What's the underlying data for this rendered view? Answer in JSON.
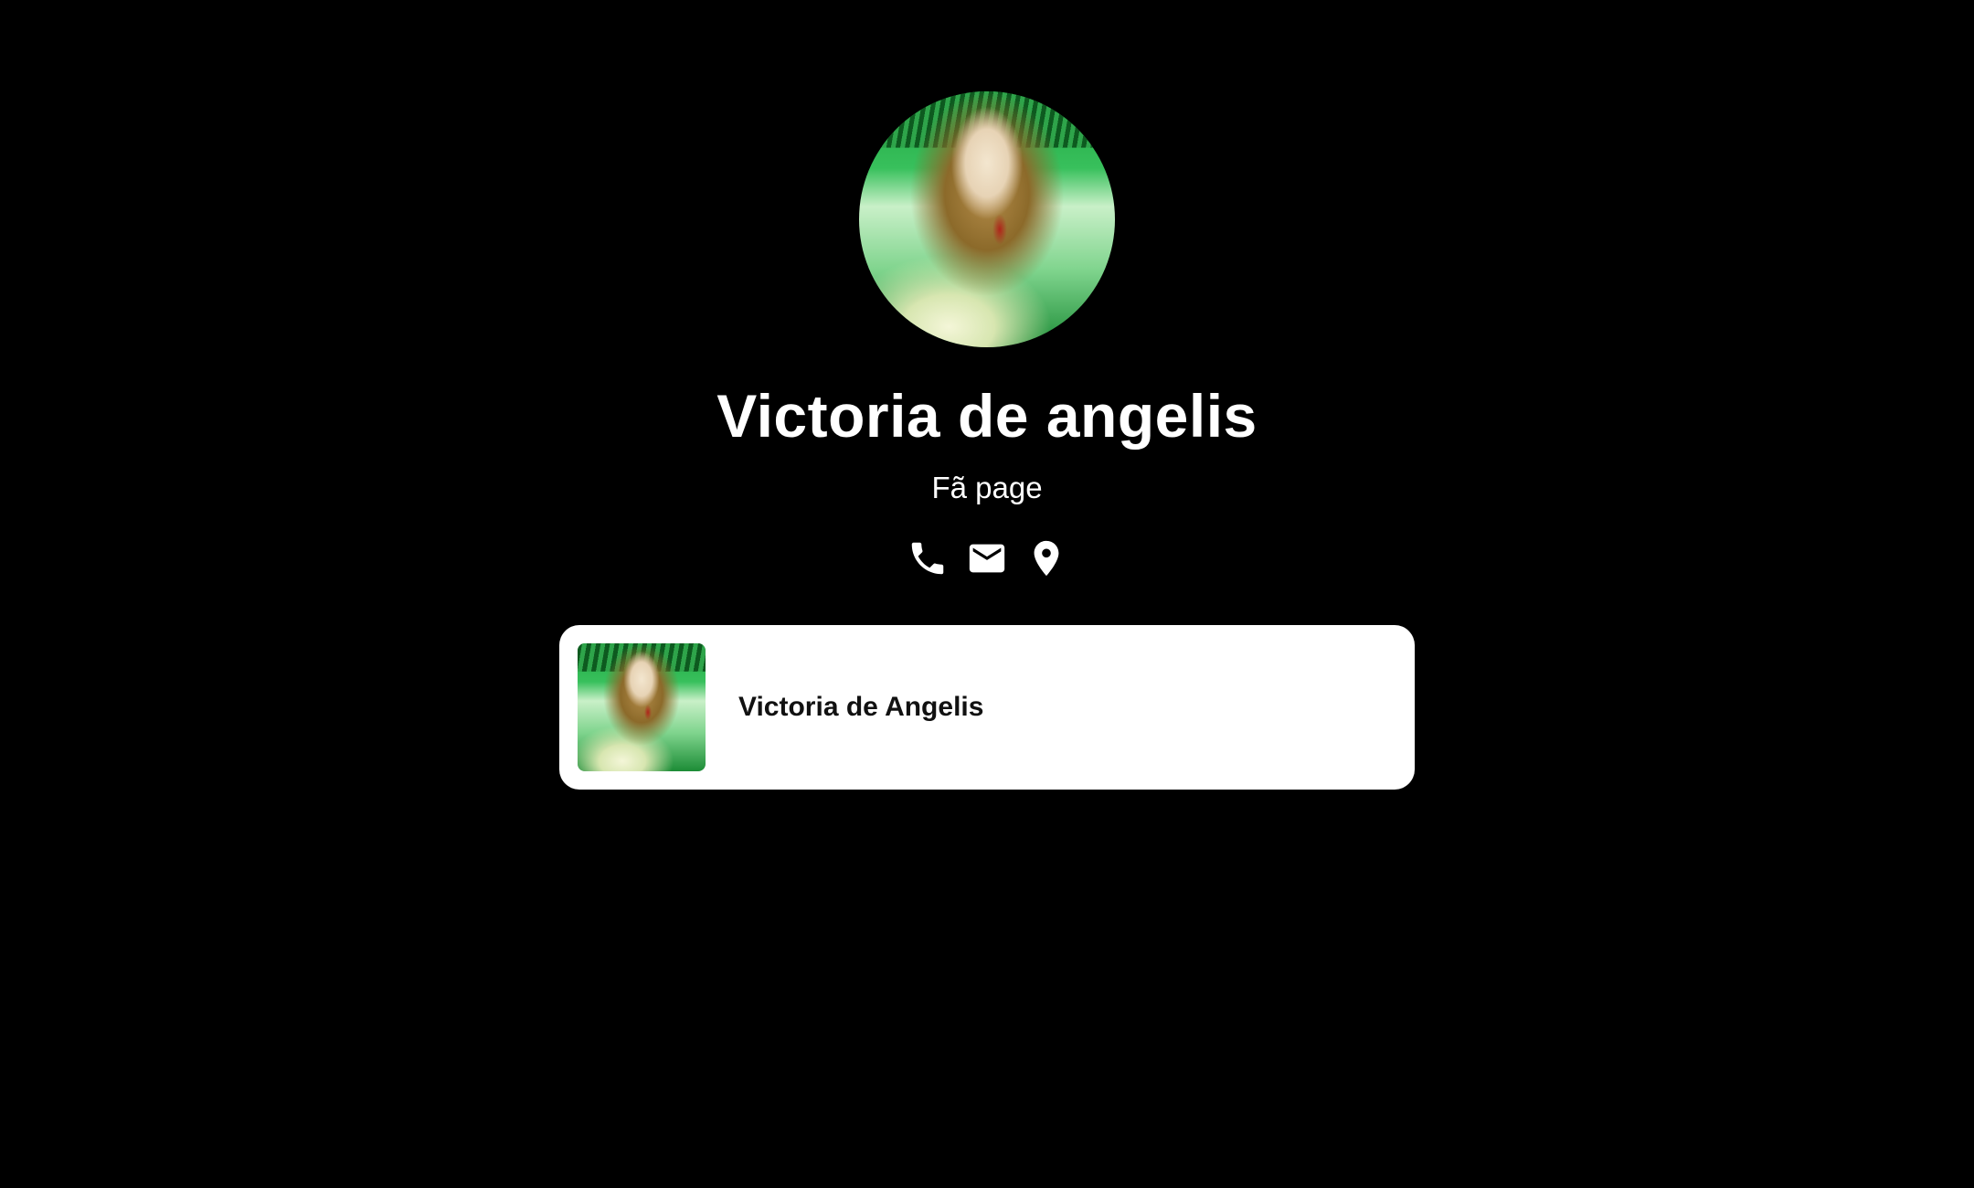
{
  "profile": {
    "name": "Victoria de angelis",
    "subtitle": "Fã page",
    "avatar_alt": "profile-photo"
  },
  "contacts": [
    {
      "icon": "phone-icon",
      "label": "Phone"
    },
    {
      "icon": "mail-icon",
      "label": "Email"
    },
    {
      "icon": "location-pin-icon",
      "label": "Location"
    }
  ],
  "links": [
    {
      "title": "Victoria de Angelis",
      "thumbnail": "photo-thumbnail"
    }
  ],
  "colors": {
    "background": "#000000",
    "text": "#ffffff",
    "card": "#ffffff",
    "card_text": "#111111"
  }
}
